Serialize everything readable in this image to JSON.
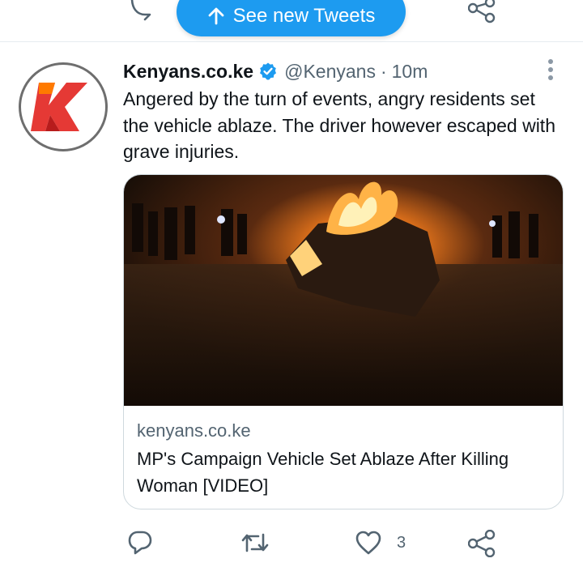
{
  "top_bar": {
    "see_new_label": "See new Tweets",
    "icons": [
      "reply-icon",
      "arrow-up-icon",
      "share-icon"
    ]
  },
  "tweet": {
    "avatar_icon": "kenyans-k-logo",
    "author_name": "Kenyans.co.ke",
    "verified_icon": "verified-badge-icon",
    "handle": "@Kenyans",
    "separator": "·",
    "time": "10m",
    "text": "Angered by the turn of events, angry residents set the vehicle ablaze. The driver however escaped with grave injuries.",
    "card": {
      "image_alt": "burning vehicle at night",
      "domain": "kenyans.co.ke",
      "title": "MP's Campaign Vehicle Set Ablaze After Killing Woman [VIDEO]"
    },
    "actions": {
      "reply_count": "",
      "retweet_count": "",
      "like_count": "3"
    }
  },
  "colors": {
    "accent": "#1d9bf0",
    "secondary_text": "#536471",
    "logo_red": "#e53935",
    "logo_orange": "#ff7a00"
  }
}
